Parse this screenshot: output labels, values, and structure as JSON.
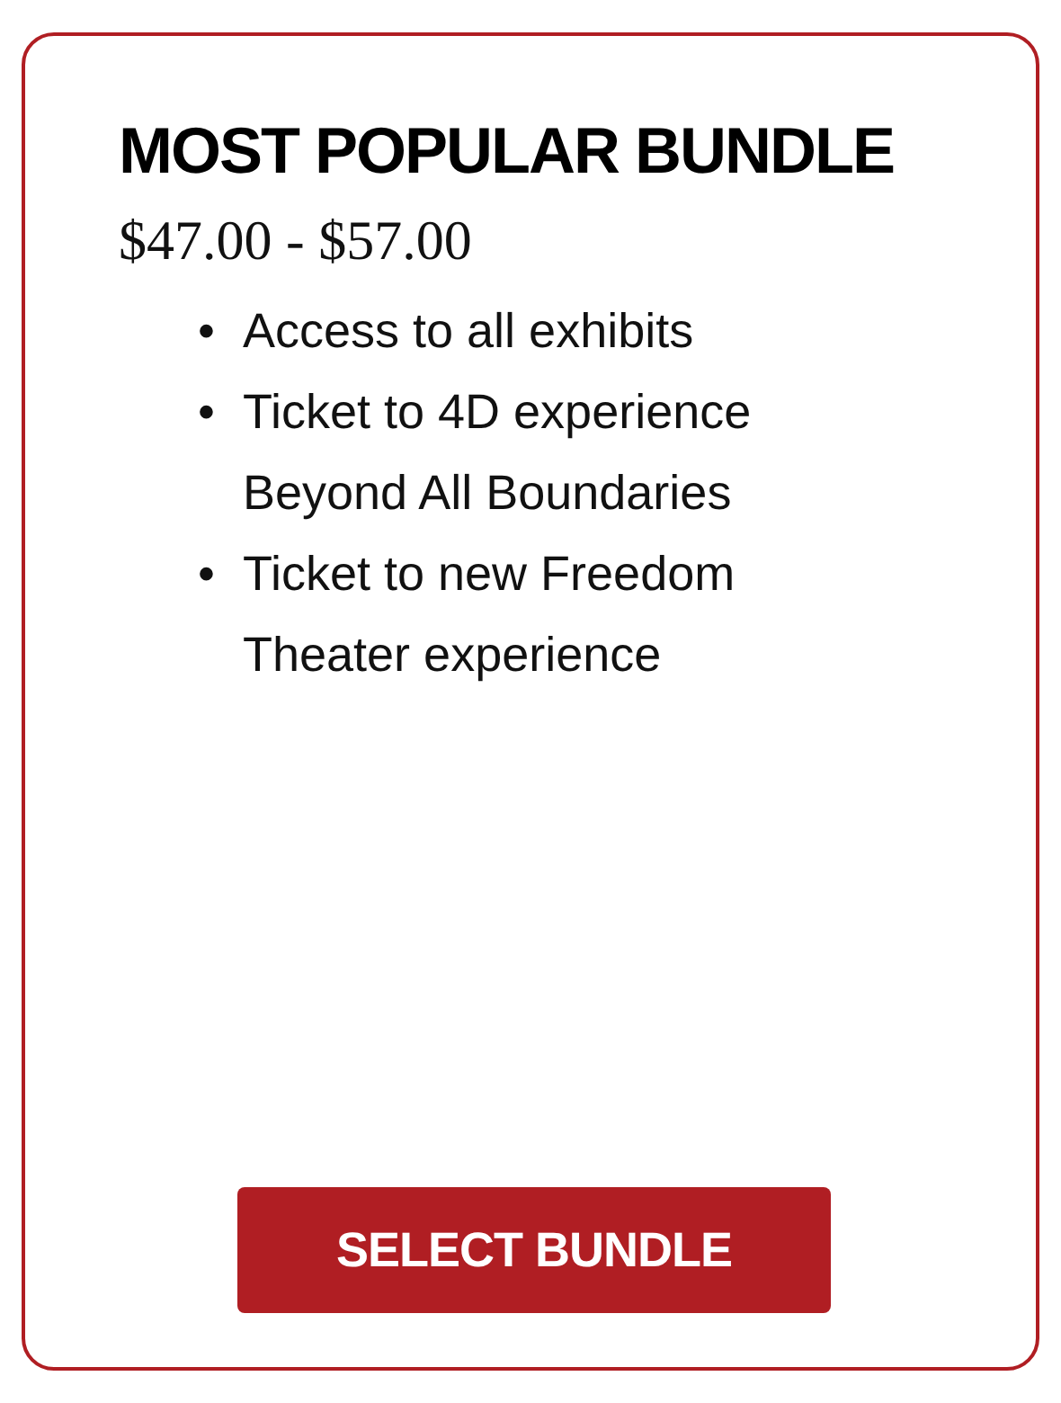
{
  "card": {
    "title": "MOST POPULAR BUNDLE",
    "price": "$47.00 - $57.00",
    "features": [
      {
        "bullet": "•",
        "text": "Access to all exhibits"
      },
      {
        "bullet": "•",
        "text": "Ticket to 4D experience Beyond All Boundaries"
      },
      {
        "bullet": "•",
        "text": "Ticket to new Freedom Theater experience"
      }
    ],
    "button": "SELECT BUNDLE"
  }
}
